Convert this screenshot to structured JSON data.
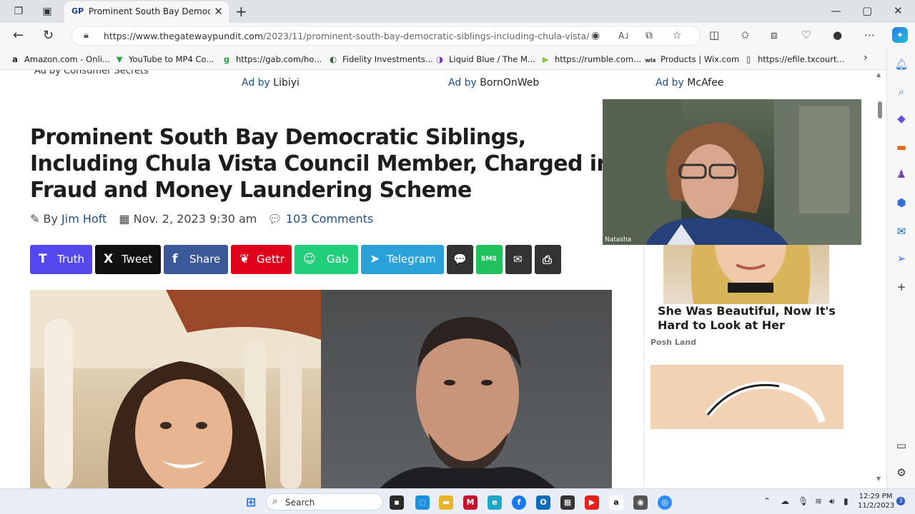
{
  "browser": {
    "tab_favicon": "GP",
    "tab_title": "Prominent South Bay Democratic Siblings",
    "tab_close": "✕",
    "new_tab": "+",
    "window_controls": [
      "—",
      "▢",
      "✕"
    ],
    "url_host": "https://www.thegatewaypundit.com",
    "url_path": "/2023/11/prominent-south-bay-democratic-siblings-including-chula-vista/",
    "read_aloud": "A˩"
  },
  "bookmarks": [
    {
      "icon": "a",
      "label": "Amazon.com - Onli..."
    },
    {
      "icon": "▼",
      "label": "YouTube to MP4 Co..."
    },
    {
      "icon": "g",
      "label": "https://gab.com/ho..."
    },
    {
      "icon": "◐",
      "label": "Fidelity Investments..."
    },
    {
      "icon": "◑",
      "label": "Liquid Blue / The M..."
    },
    {
      "icon": "▶",
      "label": "https://rumble.com..."
    },
    {
      "icon": "wix",
      "label": "Products | Wix.com"
    },
    {
      "icon": "▯",
      "label": "https://efile.txcourt..."
    }
  ],
  "ads": {
    "top_cut": "Ad by Consumer Secrets",
    "line": [
      {
        "prefix": "Ad by",
        "name": "Libiyi"
      },
      {
        "prefix": "Ad by",
        "name": "BornOnWeb"
      },
      {
        "prefix": "Ad by",
        "name": "McAfee"
      }
    ]
  },
  "article": {
    "headline_lines": [
      "Prominent South Bay Democratic Siblings,",
      "Including Chula Vista Council Member, Charged in",
      "Fraud and Money Laundering Scheme"
    ],
    "by": "By",
    "author": "Jim Hoft",
    "date": "Nov. 2, 2023 9:30 am",
    "comments": "103 Comments"
  },
  "share_buttons": [
    {
      "label": "Truth",
      "icon": "T",
      "color": "#5448ee"
    },
    {
      "label": "Tweet",
      "icon": "X",
      "color": "#111111"
    },
    {
      "label": "Share",
      "icon": "f",
      "color": "#3b5998"
    },
    {
      "label": "Gettr",
      "icon": "❦",
      "color": "#e0001b"
    },
    {
      "label": "Gab",
      "icon": "☺",
      "color": "#21cf7a"
    },
    {
      "label": "Telegram",
      "icon": "➤",
      "color": "#2aa1d9"
    },
    {
      "label": "",
      "icon": "💬",
      "color": "#333333"
    },
    {
      "label": "",
      "icon": "SMS",
      "color": "#21c25e"
    },
    {
      "label": "",
      "icon": "✉",
      "color": "#333333"
    },
    {
      "label": "",
      "icon": "⎙",
      "color": "#333333"
    }
  ],
  "sidebar_ad": {
    "title": "She Was Beautiful, Now It's Hard to Look at Her",
    "source": "Posh Land"
  },
  "webcam": {
    "name": "Natasha"
  },
  "taskbar": {
    "search_label": "Search",
    "time": "12:29 PM",
    "date": "11/2/2023",
    "notifications": "3"
  }
}
